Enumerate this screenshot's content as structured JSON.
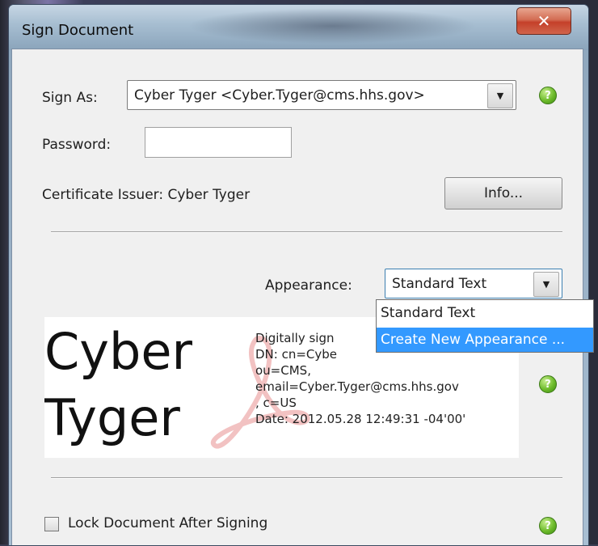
{
  "window": {
    "title": "Sign Document"
  },
  "sign_as": {
    "label": "Sign As:",
    "value": "Cyber Tyger <Cyber.Tyger@cms.hhs.gov>"
  },
  "password": {
    "label": "Password:",
    "value": ""
  },
  "certificate": {
    "issuer_text": "Certificate Issuer: Cyber Tyger",
    "info_button": "Info..."
  },
  "appearance": {
    "label": "Appearance:",
    "selected": "Standard Text",
    "options": [
      "Standard Text",
      "Create New Appearance ..."
    ],
    "highlighted_index": 1
  },
  "preview": {
    "name_line1": "Cyber",
    "name_line2": "Tyger",
    "detail_lines": [
      "Digitally sign",
      "DN: cn=Cybe",
      "ou=CMS,",
      "email=Cyber.Tyger@cms.hhs.gov",
      ", c=US",
      "Date: 2012.05.28 12:49:31 -04'00'"
    ]
  },
  "lock": {
    "label": "Lock Document After Signing",
    "checked": false
  },
  "icons": {
    "help": "help-icon",
    "close": "close-icon",
    "dropdown": "chevron-down-icon"
  },
  "colors": {
    "highlight": "#3399ff",
    "help_green": "#6dbb2b",
    "close_red": "#c4402a"
  }
}
